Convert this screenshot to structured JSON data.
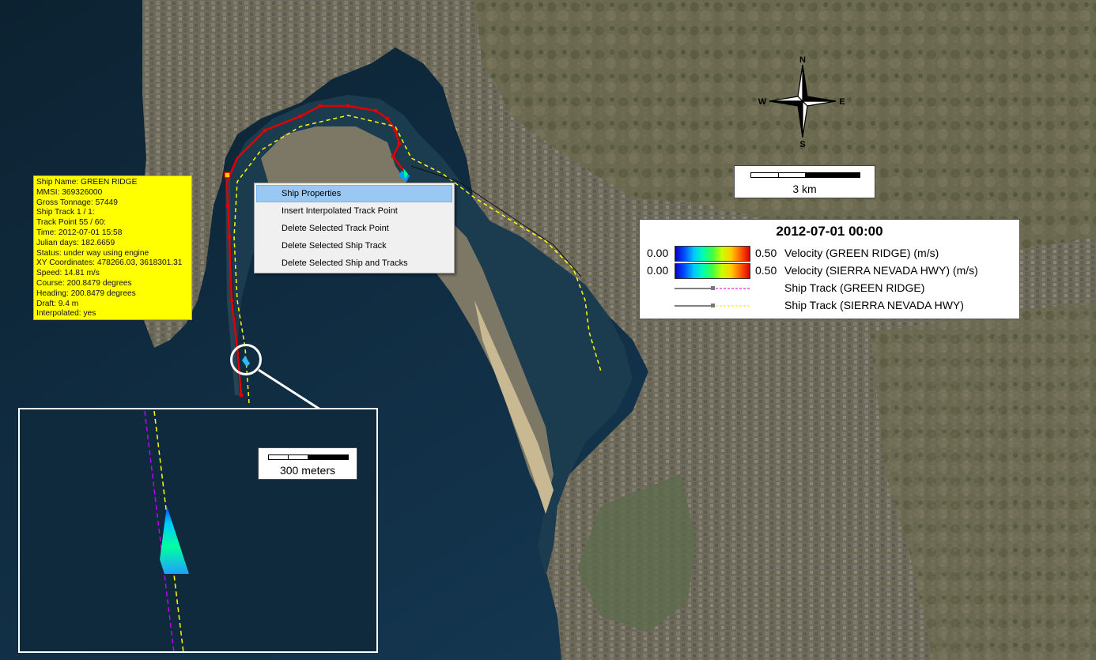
{
  "ship_info": {
    "lines": [
      "Ship Name: GREEN RIDGE",
      "MMSI: 369326000",
      "Gross Tonnage: 57449",
      "Ship Track 1 / 1:",
      "Track Point 55 / 60:",
      "Time: 2012-07-01 15:58",
      "Julian days: 182.6659",
      "Status: under way using engine",
      "XY Coordinates: 478266.03, 3618301.31",
      "Speed: 14.81 m/s",
      "Course: 200.8479 degrees",
      "Heading: 200.8479 degrees",
      "Draft: 9.4 m",
      "Interpolated: yes"
    ]
  },
  "context_menu": {
    "items": [
      {
        "label": "Ship Properties",
        "selected": true
      },
      {
        "label": "Insert Interpolated Track Point",
        "selected": false
      },
      {
        "label": "Delete Selected Track Point",
        "selected": false
      },
      {
        "label": "Delete Selected Ship Track",
        "selected": false
      },
      {
        "label": "Delete Selected Ship and Tracks",
        "selected": false
      }
    ]
  },
  "compass": {
    "n": "N",
    "s": "S",
    "e": "E",
    "w": "W"
  },
  "scale_main": {
    "label": "3 km"
  },
  "scale_inset": {
    "label": "300 meters"
  },
  "legend": {
    "title": "2012-07-01 00:00",
    "rows": [
      {
        "type": "gradient",
        "min": "0.00",
        "max": "0.50",
        "label": "Velocity (GREEN RIDGE) (m/s)"
      },
      {
        "type": "gradient",
        "min": "0.00",
        "max": "0.50",
        "label": "Velocity (SIERRA NEVADA HWY) (m/s)"
      },
      {
        "type": "track",
        "label": "Ship Track (GREEN RIDGE)",
        "color": "#c000c0"
      },
      {
        "type": "track",
        "label": "Ship Track (SIERRA NEVADA HWY)",
        "color": "#e8e800"
      }
    ]
  },
  "colors": {
    "track_green_ridge": "#e00000",
    "track_sierra_nevada": "#ffff00",
    "info_panel_bg": "#ffff00",
    "menu_highlight": "#99c9f3"
  }
}
